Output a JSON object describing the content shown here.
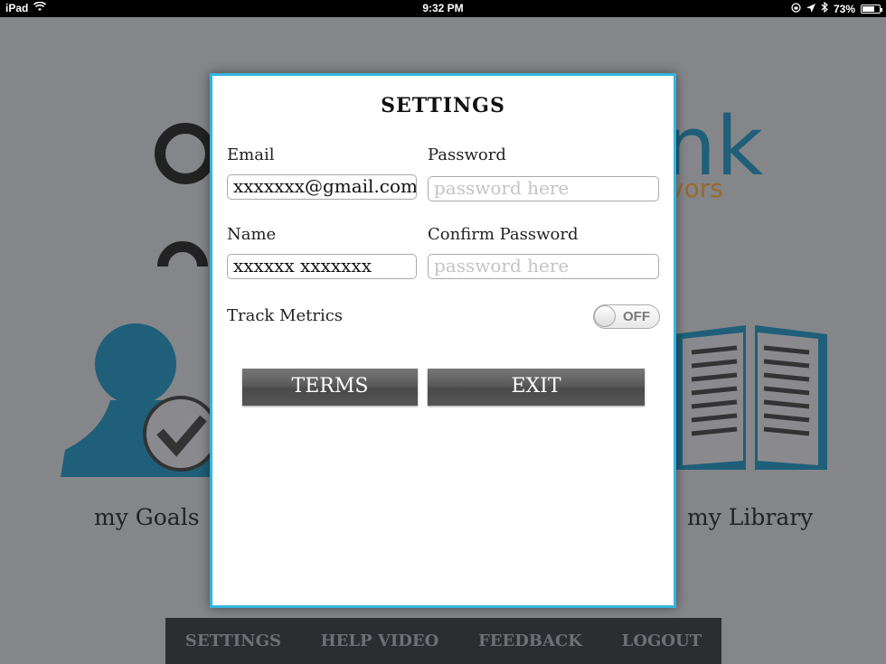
{
  "status_bar": {
    "device": "iPad",
    "time": "9:32 PM",
    "battery": "73%",
    "battery_level": 0.73
  },
  "background": {
    "logo_text": "nk",
    "logo_subtext": "vors",
    "goals_label": "my Goals",
    "library_label": "my Library",
    "accent_color": "#1f5f79"
  },
  "modal": {
    "title": "SETTINGS",
    "email": {
      "label": "Email",
      "value": "xxxxxxx@gmail.com"
    },
    "password": {
      "label": "Password",
      "placeholder": "password here"
    },
    "name": {
      "label": "Name",
      "value": "xxxxxx xxxxxxx"
    },
    "confirm_password": {
      "label": "Confirm Password",
      "placeholder": "password here"
    },
    "track_metrics": {
      "label": "Track Metrics",
      "state": "OFF"
    },
    "terms_button": "TERMS",
    "exit_button": "EXIT",
    "border_color": "#35b4e0"
  },
  "bottom_nav": {
    "items": [
      "SETTINGS",
      "HELP VIDEO",
      "FEEDBACK",
      "LOGOUT"
    ]
  }
}
